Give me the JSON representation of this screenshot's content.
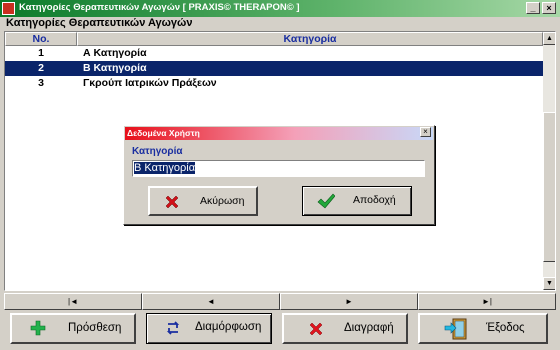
{
  "window": {
    "title": "Κατηγορίες Θεραπευτικών Αγωγών [ PRAXIS© THERAPON© ]",
    "minimize": "_",
    "close": "×"
  },
  "section_label": "Κατηγορίες Θεραπευτικών Αγωγών",
  "grid": {
    "columns": [
      "No.",
      "Κατηγορία"
    ],
    "rows": [
      {
        "no": "1",
        "name": "Α Κατηγορία"
      },
      {
        "no": "2",
        "name": "Β Κατηγορία"
      },
      {
        "no": "3",
        "name": "Γκρούπ Ιατρικών Πράξεων"
      }
    ],
    "selected_row": 2
  },
  "nav": {
    "first": "|◄",
    "prev": "◄",
    "next": "►",
    "last": "►|"
  },
  "buttons": {
    "add": "Πρόσθεση",
    "edit": "Διαμόρφωση",
    "delete": "Διαγραφή",
    "exit": "Έξοδος"
  },
  "dialog": {
    "title": "Δεδομένα Χρήστη",
    "field_label": "Κατηγορία",
    "field_value": "Β Κατηγορία",
    "cancel": "Ακύρωση",
    "accept": "Αποδοχή"
  },
  "colors": {
    "title_bar": "#0a7a2a",
    "selection": "#0a246a",
    "dialog_title": "#e8101a",
    "header_text": "#1a2ea0"
  },
  "icons": {
    "app": "app-icon",
    "add": "plus-icon",
    "edit": "swap-arrows-icon",
    "delete": "red-x-icon",
    "exit": "exit-door-icon",
    "cancel": "cancel-x-icon",
    "accept": "checkmark-icon"
  }
}
